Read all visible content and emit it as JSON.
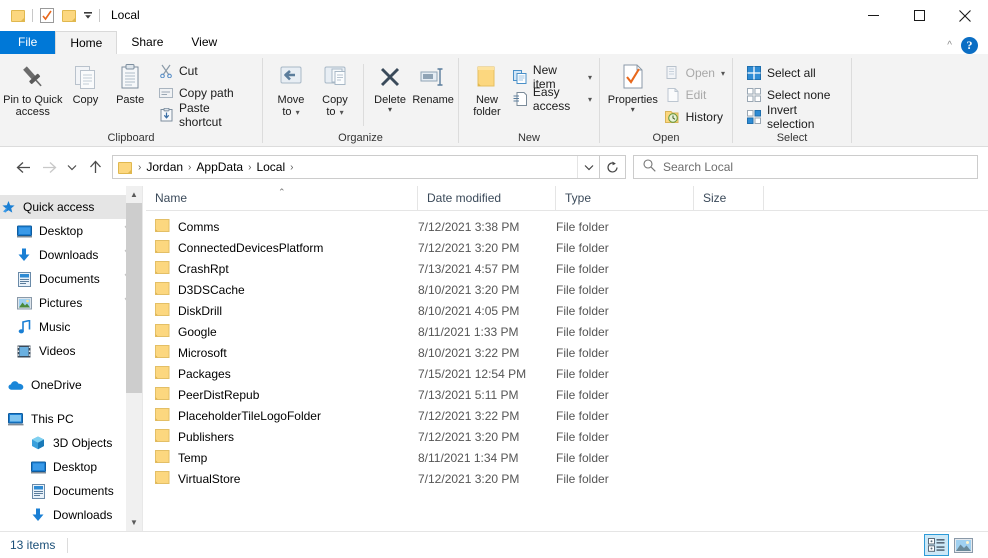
{
  "window": {
    "title": "Local",
    "quick_access_toolbar": [
      {
        "name": "folder-icon",
        "label": "Properties"
      },
      {
        "name": "properties-icon",
        "label": "Properties"
      },
      {
        "name": "new-folder-icon",
        "label": "New folder"
      },
      {
        "name": "customize-dropdown-icon",
        "label": "Customize Quick Access Toolbar"
      }
    ],
    "controls": {
      "minimize": "—",
      "maximize": "☐",
      "close": "✕"
    }
  },
  "ribbon": {
    "tabs": [
      {
        "label": "File",
        "state": "file"
      },
      {
        "label": "Home",
        "state": "active"
      },
      {
        "label": "Share",
        "state": "normal"
      },
      {
        "label": "View",
        "state": "normal"
      }
    ],
    "collapse_label": "^",
    "help_label": "?",
    "groups": [
      {
        "name": "Clipboard",
        "big_buttons": [
          {
            "label_line1": "Pin to Quick",
            "label_line2": "access",
            "icon": "pin-icon",
            "dim": false
          },
          {
            "label_line1": "Copy",
            "label_line2": "",
            "icon": "copy-icon",
            "dim": true
          },
          {
            "label_line1": "Paste",
            "label_line2": "",
            "icon": "paste-icon",
            "dim": false
          }
        ],
        "small_buttons": [
          {
            "label": "Cut",
            "icon": "scissors-icon",
            "dim": false,
            "caret": false
          },
          {
            "label": "Copy path",
            "icon": "copy-path-icon",
            "dim": false,
            "caret": false
          },
          {
            "label": "Paste shortcut",
            "icon": "paste-shortcut-icon",
            "dim": false,
            "caret": false
          }
        ]
      },
      {
        "name": "Organize",
        "big_buttons": [
          {
            "label_line1": "Move",
            "label_line2": "to",
            "icon": "move-to-icon",
            "dim": true,
            "caret": true
          },
          {
            "label_line1": "Copy",
            "label_line2": "to",
            "icon": "copy-to-icon",
            "dim": true,
            "caret": true
          },
          {
            "label_line1": "Delete",
            "label_line2": "",
            "icon": "delete-icon",
            "dim": false,
            "caret": true
          },
          {
            "label_line1": "Rename",
            "label_line2": "",
            "icon": "rename-icon",
            "dim": false,
            "caret": false
          }
        ],
        "small_buttons": []
      },
      {
        "name": "New",
        "big_buttons": [
          {
            "label_line1": "New",
            "label_line2": "folder",
            "icon": "new-folder-icon",
            "dim": false
          }
        ],
        "small_buttons": [
          {
            "label": "New item",
            "icon": "new-item-icon",
            "dim": false,
            "caret": true
          },
          {
            "label": "Easy access",
            "icon": "easy-access-icon",
            "dim": false,
            "caret": true
          }
        ]
      },
      {
        "name": "Open",
        "big_buttons": [
          {
            "label_line1": "Properties",
            "label_line2": "",
            "icon": "properties-icon",
            "dim": false,
            "caret": true
          }
        ],
        "small_buttons": [
          {
            "label": "Open",
            "icon": "open-icon",
            "dim": true,
            "caret": true
          },
          {
            "label": "Edit",
            "icon": "edit-icon",
            "dim": true,
            "caret": false
          },
          {
            "label": "History",
            "icon": "history-icon",
            "dim": false,
            "caret": false
          }
        ]
      },
      {
        "name": "Select",
        "big_buttons": [],
        "small_buttons": [
          {
            "label": "Select all",
            "icon": "select-all-icon",
            "dim": false,
            "caret": false
          },
          {
            "label": "Select none",
            "icon": "select-none-icon",
            "dim": false,
            "caret": false
          },
          {
            "label": "Invert selection",
            "icon": "invert-selection-icon",
            "dim": false,
            "caret": false
          }
        ]
      }
    ]
  },
  "navbar": {
    "back": "←",
    "forward": "→",
    "recent": "⌄",
    "up": "↑",
    "breadcrumbs": [
      "Jordan",
      "AppData",
      "Local"
    ],
    "breadcrumb_separator": "›",
    "dropdown": "⌄",
    "refresh": "↻",
    "search_placeholder": "Search Local",
    "search_value": ""
  },
  "sidebar": {
    "items": [
      {
        "label": "Quick access",
        "icon": "quick-access-star-icon",
        "level": 0,
        "selected": true,
        "pinned": false
      },
      {
        "label": "Desktop",
        "icon": "desktop-icon",
        "level": 1,
        "selected": false,
        "pinned": true
      },
      {
        "label": "Downloads",
        "icon": "downloads-icon",
        "level": 1,
        "selected": false,
        "pinned": true
      },
      {
        "label": "Documents",
        "icon": "documents-icon",
        "level": 1,
        "selected": false,
        "pinned": true
      },
      {
        "label": "Pictures",
        "icon": "pictures-icon",
        "level": 1,
        "selected": false,
        "pinned": true
      },
      {
        "label": "Music",
        "icon": "music-icon",
        "level": 1,
        "selected": false,
        "pinned": false
      },
      {
        "label": "Videos",
        "icon": "videos-icon",
        "level": 1,
        "selected": false,
        "pinned": false
      },
      {
        "label": "OneDrive",
        "icon": "onedrive-cloud-icon",
        "level": 0,
        "selected": false,
        "pinned": false,
        "gap_before": true
      },
      {
        "label": "This PC",
        "icon": "this-pc-icon",
        "level": 0,
        "selected": false,
        "pinned": false,
        "gap_before": true
      },
      {
        "label": "3D Objects",
        "icon": "3d-objects-icon",
        "level": 1,
        "selected": false,
        "pinned": false
      },
      {
        "label": "Desktop",
        "icon": "desktop-icon",
        "level": 1,
        "selected": false,
        "pinned": false
      },
      {
        "label": "Documents",
        "icon": "documents-icon",
        "level": 1,
        "selected": false,
        "pinned": false
      },
      {
        "label": "Downloads",
        "icon": "downloads-icon",
        "level": 1,
        "selected": false,
        "pinned": false
      }
    ]
  },
  "filelist": {
    "columns": [
      {
        "key": "name",
        "label": "Name",
        "sorted": "asc"
      },
      {
        "key": "date",
        "label": "Date modified",
        "sorted": null
      },
      {
        "key": "type",
        "label": "Type",
        "sorted": null
      },
      {
        "key": "size",
        "label": "Size",
        "sorted": null
      }
    ],
    "sort_caret": "⌃",
    "rows": [
      {
        "name": "Comms",
        "date": "7/12/2021 3:38 PM",
        "type": "File folder",
        "size": ""
      },
      {
        "name": "ConnectedDevicesPlatform",
        "date": "7/12/2021 3:20 PM",
        "type": "File folder",
        "size": ""
      },
      {
        "name": "CrashRpt",
        "date": "7/13/2021 4:57 PM",
        "type": "File folder",
        "size": ""
      },
      {
        "name": "D3DSCache",
        "date": "8/10/2021 3:20 PM",
        "type": "File folder",
        "size": ""
      },
      {
        "name": "DiskDrill",
        "date": "8/10/2021 4:05 PM",
        "type": "File folder",
        "size": ""
      },
      {
        "name": "Google",
        "date": "8/11/2021 1:33 PM",
        "type": "File folder",
        "size": ""
      },
      {
        "name": "Microsoft",
        "date": "8/10/2021 3:22 PM",
        "type": "File folder",
        "size": ""
      },
      {
        "name": "Packages",
        "date": "7/15/2021 12:54 PM",
        "type": "File folder",
        "size": ""
      },
      {
        "name": "PeerDistRepub",
        "date": "7/13/2021 5:11 PM",
        "type": "File folder",
        "size": ""
      },
      {
        "name": "PlaceholderTileLogoFolder",
        "date": "7/12/2021 3:22 PM",
        "type": "File folder",
        "size": ""
      },
      {
        "name": "Publishers",
        "date": "7/12/2021 3:20 PM",
        "type": "File folder",
        "size": ""
      },
      {
        "name": "Temp",
        "date": "8/11/2021 1:34 PM",
        "type": "File folder",
        "size": ""
      },
      {
        "name": "VirtualStore",
        "date": "7/12/2021 3:20 PM",
        "type": "File folder",
        "size": ""
      }
    ]
  },
  "statusbar": {
    "item_count": "13 items",
    "views": [
      {
        "name": "details-view-button",
        "label": "Details view",
        "active": true
      },
      {
        "name": "large-icons-view-button",
        "label": "Large icons view",
        "active": false
      }
    ]
  },
  "colors": {
    "accent": "#0078d7",
    "ribbon_bg": "#f3f3f3",
    "folder_yellow": "#fcd77f",
    "selection": "#e5e5e5",
    "status_text": "#1a4f78"
  }
}
